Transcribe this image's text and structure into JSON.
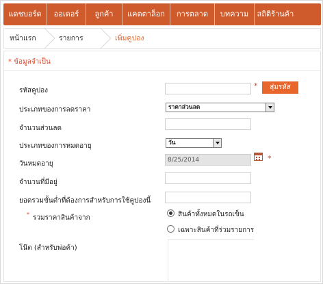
{
  "nav": {
    "items": [
      {
        "label": "แดชบอร์ด"
      },
      {
        "label": "ออเดอร์"
      },
      {
        "label": "ลูกค้า"
      },
      {
        "label": "แคตตาล็อก"
      },
      {
        "label": "การตลาด"
      },
      {
        "label": "บทความ"
      },
      {
        "label": "สถิติร้านค้า"
      }
    ]
  },
  "breadcrumb": {
    "home": "หน้าแรก",
    "list": "รายการคูปอง",
    "current": "เพิ่มคูปอง"
  },
  "form": {
    "required_note": "* ข้อมูลจำเป็น",
    "coupon_code_label": "รหัสคูปอง",
    "coupon_code_value": "",
    "random_button": "สุ่มรหัส",
    "discount_type_label": "ประเภทของการลดราคา",
    "discount_type_value": "ราคาส่วนลด",
    "discount_amount_label": "จำนวนส่วนลด",
    "discount_amount_value": "",
    "expiry_type_label": "ประเภทของการหมดอายุ",
    "expiry_type_value": "วัน",
    "expiry_date_label": "วันหมดอายุ",
    "expiry_date_value": "8/25/2014",
    "remaining_label": "จำนวนที่มีอยู่",
    "remaining_value": "",
    "min_total_label": "ยอดรวมขั้นต่ำที่ต้องการสำหรับการใช้คูปองนี้",
    "min_total_value": "",
    "price_total_label": "รวมราคาสินค้าจาก",
    "price_total_options": [
      "สินค้าทั้งหมดในรถเข็น",
      "เฉพาะสินค้าที่ร่วมรายการ"
    ],
    "price_total_selected": "สินค้าทั้งหมดในรถเข็น",
    "notes_label": "โน๊ต (สำหรับพ่อค้า)"
  },
  "colors": {
    "accent": "#e8662c",
    "nav_bg": "#cf5a2b",
    "required": "#d8442a"
  }
}
